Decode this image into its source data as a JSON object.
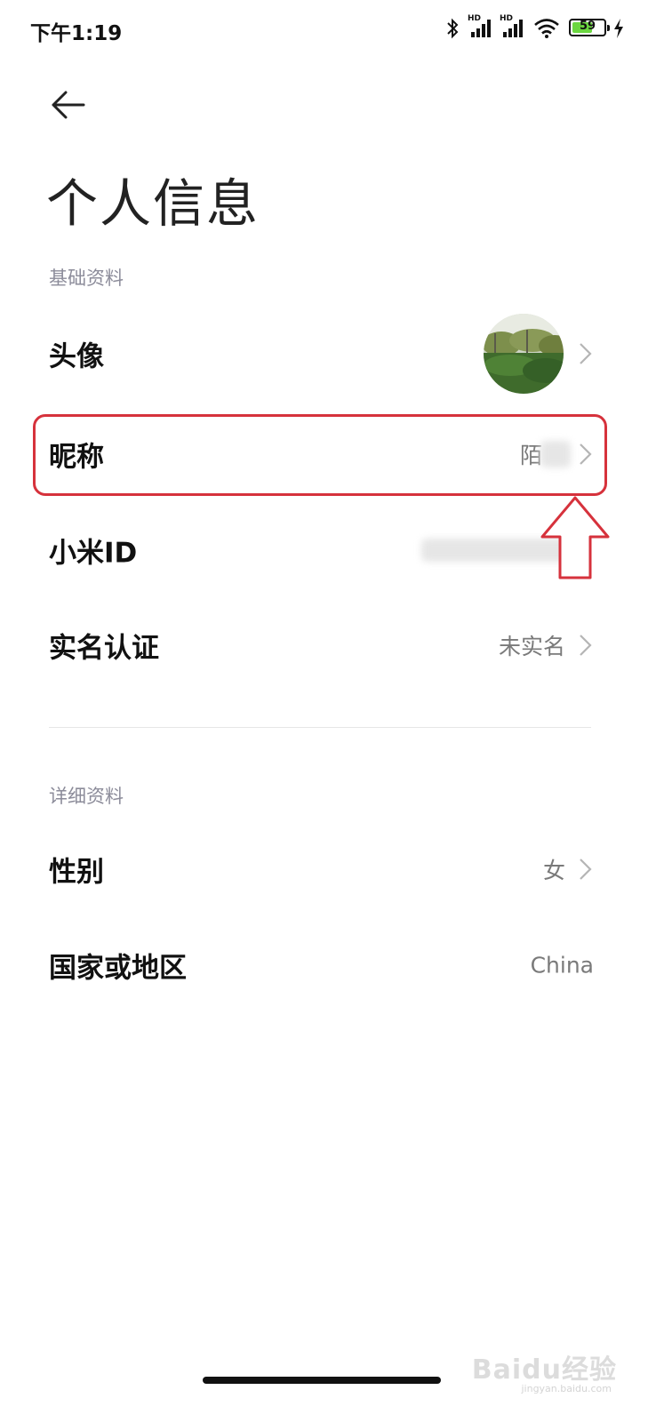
{
  "status_bar": {
    "time": "下午1:19",
    "hd1": "HD",
    "hd2": "HD",
    "battery": "59",
    "icons": [
      "bluetooth-icon",
      "signal-icon",
      "signal-icon",
      "wifi-icon",
      "battery-icon",
      "charging-icon"
    ]
  },
  "header": {
    "back_icon": "back-arrow-icon",
    "title": "个人信息"
  },
  "basic_section": {
    "label": "基础资料",
    "rows": [
      {
        "label": "头像",
        "value": ""
      },
      {
        "label": "昵称",
        "value": "陌"
      },
      {
        "label": "小米ID",
        "value": ""
      },
      {
        "label": "实名认证",
        "value": "未实名"
      }
    ]
  },
  "detail_section": {
    "label": "详细资料",
    "rows": [
      {
        "label": "性别",
        "value": "女"
      },
      {
        "label": "国家或地区",
        "value": "China"
      }
    ]
  },
  "watermark": {
    "text": "Baidu经验",
    "sub": "jingyan.baidu.com"
  },
  "colors": {
    "accent_highlight": "#d6323c",
    "battery_green": "#6bd640",
    "secondary_text": "#7a7a7a",
    "section_label": "#8c8c9a"
  }
}
